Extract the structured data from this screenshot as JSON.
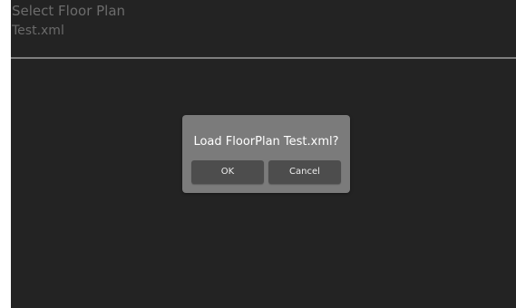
{
  "header": {
    "title": "Select Floor Plan"
  },
  "file_list": {
    "items": [
      {
        "label": "Test.xml"
      }
    ]
  },
  "dialog": {
    "message": "Load FloorPlan Test.xml?",
    "ok_label": "OK",
    "cancel_label": "Cancel"
  }
}
